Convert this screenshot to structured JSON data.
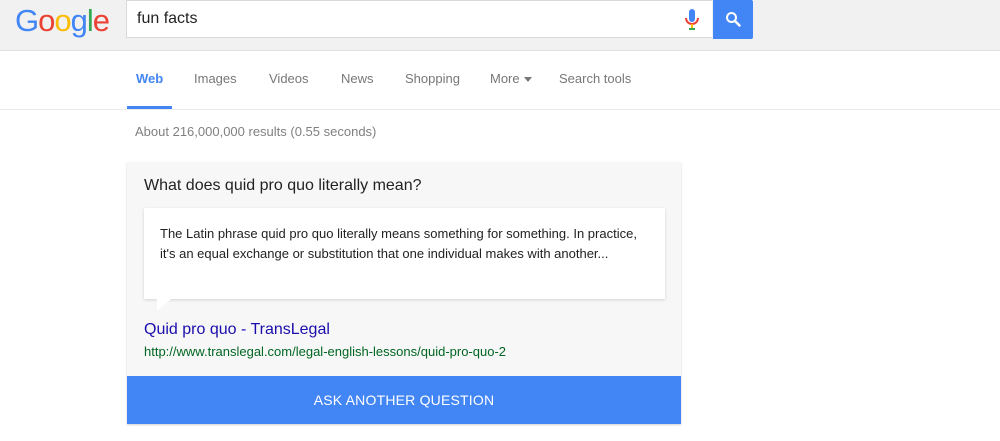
{
  "logo": {
    "letters": [
      "G",
      "o",
      "o",
      "g",
      "l",
      "e"
    ]
  },
  "search": {
    "query": "fun facts"
  },
  "tabs": [
    {
      "label": "Web",
      "active": true
    },
    {
      "label": "Images"
    },
    {
      "label": "Videos"
    },
    {
      "label": "News"
    },
    {
      "label": "Shopping"
    },
    {
      "label": "More"
    },
    {
      "label": "Search tools"
    }
  ],
  "stats": "About 216,000,000 results (0.55 seconds)",
  "answer": {
    "question": "What does quid pro quo literally mean?",
    "snippet": "The Latin phrase quid pro quo literally means something for something. In practice, it's an equal exchange or substitution that one individual makes with another...",
    "result_title": "Quid pro quo - TransLegal",
    "result_url": "http://www.translegal.com/legal-english-lessons/quid-pro-quo-2",
    "ask_button": "ASK ANOTHER QUESTION"
  },
  "colors": {
    "blue": "#4285f4",
    "red": "#ea4335",
    "yellow": "#fbbc05",
    "green": "#34a853"
  }
}
